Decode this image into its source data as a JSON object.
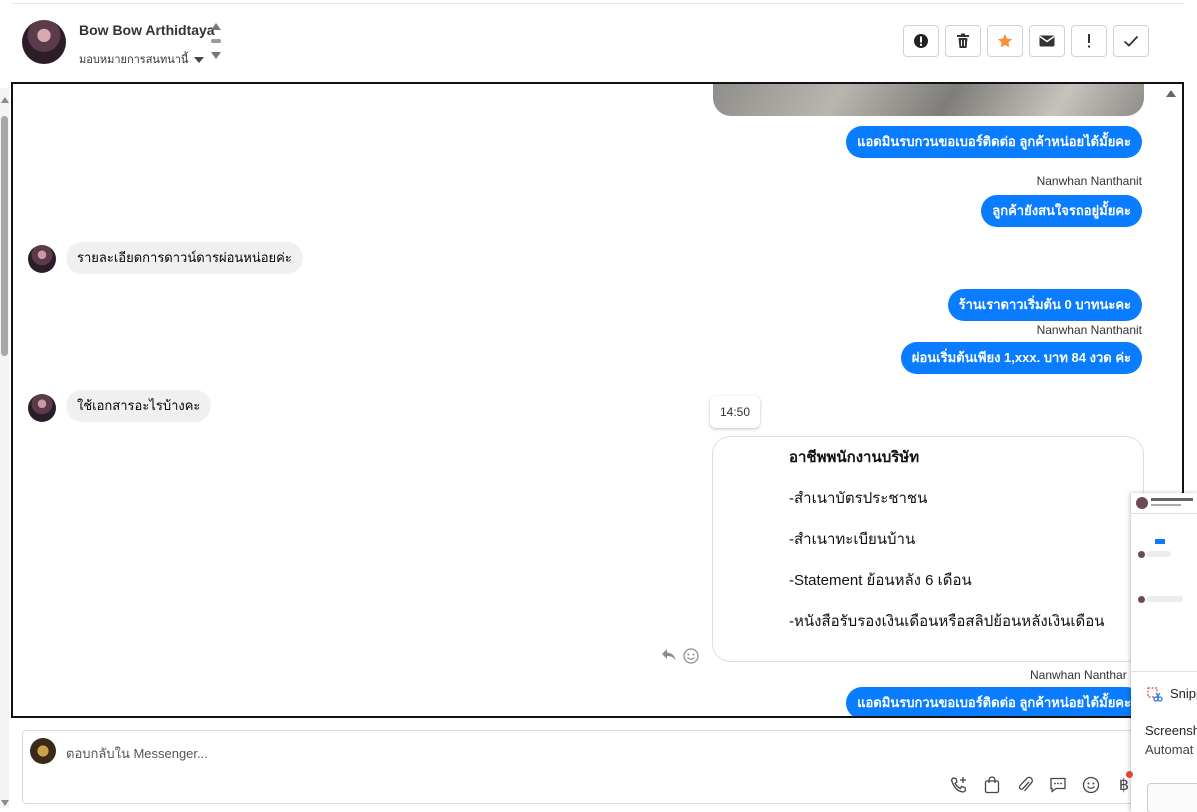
{
  "header": {
    "contact_name": "Bow Bow Arthidtaya",
    "assign_label": "มอบหมายการสนทนานี้",
    "actions": [
      {
        "icon": "alert-circle-icon"
      },
      {
        "icon": "trash-icon"
      },
      {
        "icon": "star-icon",
        "color": "#f7923a"
      },
      {
        "icon": "envelope-icon"
      },
      {
        "icon": "exclamation-icon"
      },
      {
        "icon": "check-icon"
      }
    ]
  },
  "messages": {
    "m1": "แอดมินรบกวนขอเบอร์ติดต่อ ลูกค้าหน่อยได้มั้ยคะ",
    "sender1": "Nanwhan Nanthanit",
    "m2": "ลูกค้ายังสนใจรถอยู่มั้ยคะ",
    "in1": "รายละเอียดการดาวน์ดารผ่อนหน่อยค่ะ",
    "m3": "ร้านเราดาวเริ่มต้น 0 บาทนะคะ",
    "sender2": "Nanwhan Nanthanit",
    "m4": "ผ่อนเริ่มต้นเพียง 1,xxx. บาท 84 งวด ค่ะ",
    "in2": "ใช้เอกสารอะไรบ้างคะ",
    "time": "14:50",
    "doc": {
      "title": "อาชีพพนักงานบริษัท",
      "items": [
        "-สำเนาบัตรประชาชน",
        "-สำเนาทะเบียนบ้าน",
        "-Statement ย้อนหลัง 6 เดือน",
        "-หนังสือรับรองเงินเดือนหรือสลิปย้อนหลังเงินเดือน"
      ]
    },
    "sender3": "Nanwhan Nanthar",
    "m5": "แอดมินรบกวนขอเบอร์ติดต่อ ลูกค้าหน่อยได้มั้ยคะ"
  },
  "composer": {
    "placeholder": "ตอบกลับใน Messenger..."
  },
  "colors": {
    "accent": "#0a7cff",
    "incoming": "#f0f0f0"
  },
  "snip": {
    "title": "Snipp",
    "body1": "Screensh",
    "body2": "Automat"
  }
}
